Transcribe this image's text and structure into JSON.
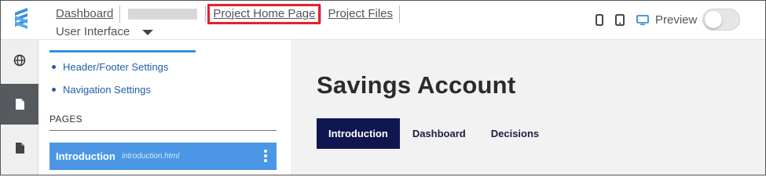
{
  "topbar": {
    "nav": {
      "dashboard": "Dashboard",
      "project_home": "Project Home Page",
      "project_files": "Project Files"
    },
    "ui_select": "User Interface",
    "devices": [
      "phone-icon",
      "tablet-icon",
      "desktop-icon"
    ],
    "preview_label": "Preview",
    "preview_on": false
  },
  "sidebar": {
    "settings": [
      "Header/Footer Settings",
      "Navigation Settings"
    ],
    "pages_heading": "PAGES",
    "pages": [
      {
        "name": "Introduction",
        "file": "introduction.html"
      }
    ]
  },
  "preview": {
    "title": "Savings Account",
    "tabs": [
      "Introduction",
      "Dashboard",
      "Decisions"
    ]
  },
  "colors": {
    "accent": "#4b97e6",
    "highlight": "#e8202a",
    "tab_active": "#101650",
    "link": "#1f5fa8"
  }
}
